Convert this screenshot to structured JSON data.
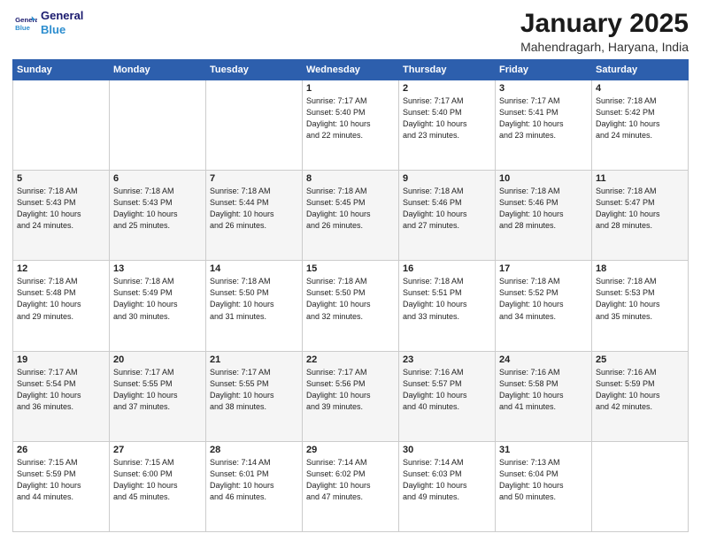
{
  "logo": {
    "line1": "General",
    "line2": "Blue"
  },
  "header": {
    "title": "January 2025",
    "subtitle": "Mahendragarh, Haryana, India"
  },
  "weekdays": [
    "Sunday",
    "Monday",
    "Tuesday",
    "Wednesday",
    "Thursday",
    "Friday",
    "Saturday"
  ],
  "weeks": [
    [
      {
        "day": "",
        "info": ""
      },
      {
        "day": "",
        "info": ""
      },
      {
        "day": "",
        "info": ""
      },
      {
        "day": "1",
        "info": "Sunrise: 7:17 AM\nSunset: 5:40 PM\nDaylight: 10 hours\nand 22 minutes."
      },
      {
        "day": "2",
        "info": "Sunrise: 7:17 AM\nSunset: 5:40 PM\nDaylight: 10 hours\nand 23 minutes."
      },
      {
        "day": "3",
        "info": "Sunrise: 7:17 AM\nSunset: 5:41 PM\nDaylight: 10 hours\nand 23 minutes."
      },
      {
        "day": "4",
        "info": "Sunrise: 7:18 AM\nSunset: 5:42 PM\nDaylight: 10 hours\nand 24 minutes."
      }
    ],
    [
      {
        "day": "5",
        "info": "Sunrise: 7:18 AM\nSunset: 5:43 PM\nDaylight: 10 hours\nand 24 minutes."
      },
      {
        "day": "6",
        "info": "Sunrise: 7:18 AM\nSunset: 5:43 PM\nDaylight: 10 hours\nand 25 minutes."
      },
      {
        "day": "7",
        "info": "Sunrise: 7:18 AM\nSunset: 5:44 PM\nDaylight: 10 hours\nand 26 minutes."
      },
      {
        "day": "8",
        "info": "Sunrise: 7:18 AM\nSunset: 5:45 PM\nDaylight: 10 hours\nand 26 minutes."
      },
      {
        "day": "9",
        "info": "Sunrise: 7:18 AM\nSunset: 5:46 PM\nDaylight: 10 hours\nand 27 minutes."
      },
      {
        "day": "10",
        "info": "Sunrise: 7:18 AM\nSunset: 5:46 PM\nDaylight: 10 hours\nand 28 minutes."
      },
      {
        "day": "11",
        "info": "Sunrise: 7:18 AM\nSunset: 5:47 PM\nDaylight: 10 hours\nand 28 minutes."
      }
    ],
    [
      {
        "day": "12",
        "info": "Sunrise: 7:18 AM\nSunset: 5:48 PM\nDaylight: 10 hours\nand 29 minutes."
      },
      {
        "day": "13",
        "info": "Sunrise: 7:18 AM\nSunset: 5:49 PM\nDaylight: 10 hours\nand 30 minutes."
      },
      {
        "day": "14",
        "info": "Sunrise: 7:18 AM\nSunset: 5:50 PM\nDaylight: 10 hours\nand 31 minutes."
      },
      {
        "day": "15",
        "info": "Sunrise: 7:18 AM\nSunset: 5:50 PM\nDaylight: 10 hours\nand 32 minutes."
      },
      {
        "day": "16",
        "info": "Sunrise: 7:18 AM\nSunset: 5:51 PM\nDaylight: 10 hours\nand 33 minutes."
      },
      {
        "day": "17",
        "info": "Sunrise: 7:18 AM\nSunset: 5:52 PM\nDaylight: 10 hours\nand 34 minutes."
      },
      {
        "day": "18",
        "info": "Sunrise: 7:18 AM\nSunset: 5:53 PM\nDaylight: 10 hours\nand 35 minutes."
      }
    ],
    [
      {
        "day": "19",
        "info": "Sunrise: 7:17 AM\nSunset: 5:54 PM\nDaylight: 10 hours\nand 36 minutes."
      },
      {
        "day": "20",
        "info": "Sunrise: 7:17 AM\nSunset: 5:55 PM\nDaylight: 10 hours\nand 37 minutes."
      },
      {
        "day": "21",
        "info": "Sunrise: 7:17 AM\nSunset: 5:55 PM\nDaylight: 10 hours\nand 38 minutes."
      },
      {
        "day": "22",
        "info": "Sunrise: 7:17 AM\nSunset: 5:56 PM\nDaylight: 10 hours\nand 39 minutes."
      },
      {
        "day": "23",
        "info": "Sunrise: 7:16 AM\nSunset: 5:57 PM\nDaylight: 10 hours\nand 40 minutes."
      },
      {
        "day": "24",
        "info": "Sunrise: 7:16 AM\nSunset: 5:58 PM\nDaylight: 10 hours\nand 41 minutes."
      },
      {
        "day": "25",
        "info": "Sunrise: 7:16 AM\nSunset: 5:59 PM\nDaylight: 10 hours\nand 42 minutes."
      }
    ],
    [
      {
        "day": "26",
        "info": "Sunrise: 7:15 AM\nSunset: 5:59 PM\nDaylight: 10 hours\nand 44 minutes."
      },
      {
        "day": "27",
        "info": "Sunrise: 7:15 AM\nSunset: 6:00 PM\nDaylight: 10 hours\nand 45 minutes."
      },
      {
        "day": "28",
        "info": "Sunrise: 7:14 AM\nSunset: 6:01 PM\nDaylight: 10 hours\nand 46 minutes."
      },
      {
        "day": "29",
        "info": "Sunrise: 7:14 AM\nSunset: 6:02 PM\nDaylight: 10 hours\nand 47 minutes."
      },
      {
        "day": "30",
        "info": "Sunrise: 7:14 AM\nSunset: 6:03 PM\nDaylight: 10 hours\nand 49 minutes."
      },
      {
        "day": "31",
        "info": "Sunrise: 7:13 AM\nSunset: 6:04 PM\nDaylight: 10 hours\nand 50 minutes."
      },
      {
        "day": "",
        "info": ""
      }
    ]
  ]
}
